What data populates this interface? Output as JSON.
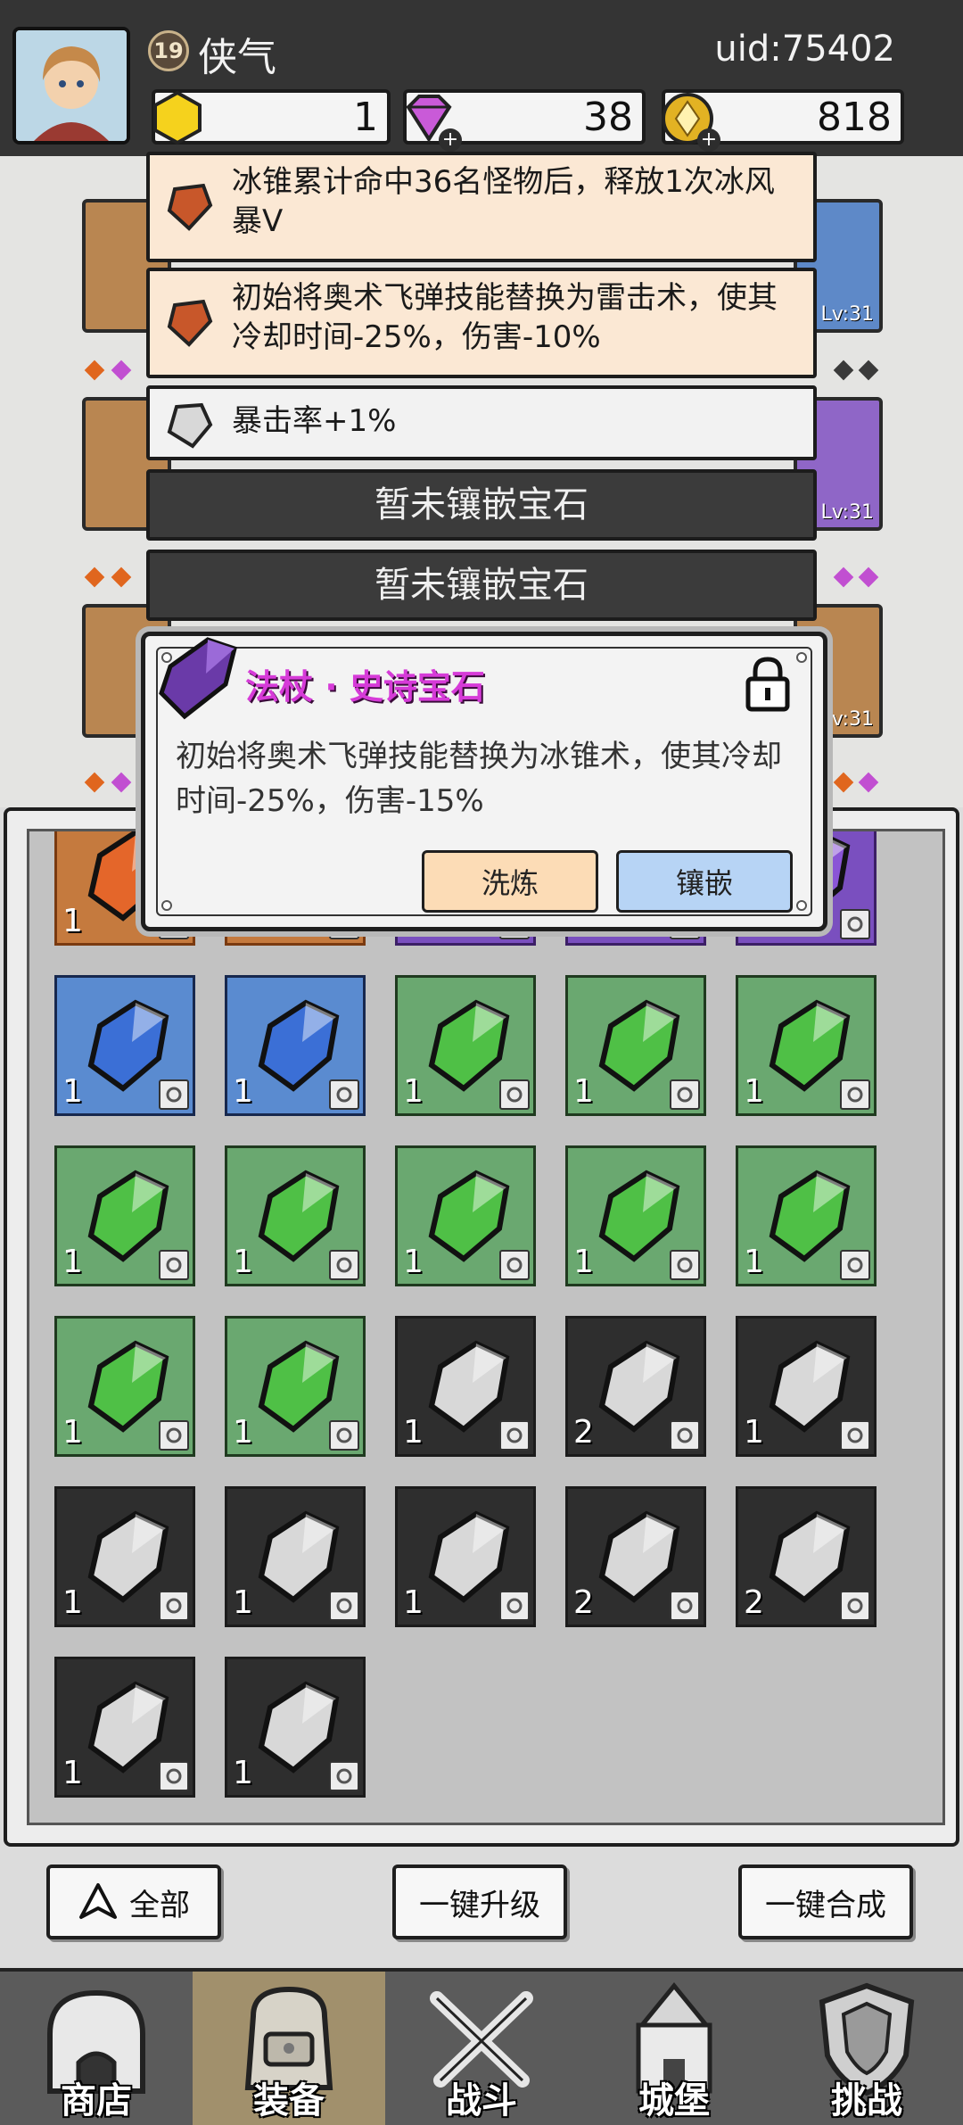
{
  "player": {
    "level": "19",
    "name": "侠气",
    "uid": "uid:75402"
  },
  "resources": [
    {
      "name": "yellow-gem",
      "value": "1",
      "color": "#f5d21d"
    },
    {
      "name": "purple-diamond",
      "value": "38",
      "color": "#c95ad8"
    },
    {
      "name": "gold-coin",
      "value": "818",
      "color": "#e2b223"
    }
  ],
  "sockets": [
    {
      "text": "冰锥累计命中36名怪物后，释放1次冰风暴V"
    },
    {
      "text": "初始将奥术飞弹技能替换为雷击术，使其冷却时间-25%，伤害-10%"
    },
    {
      "text": "暴击率+1%"
    },
    {
      "text": "暂未镶嵌宝石"
    },
    {
      "text": "暂未镶嵌宝石"
    }
  ],
  "equip_levels": [
    "Lv:31",
    "Lv:31",
    "Lv:31"
  ],
  "popup": {
    "title": "法杖 · 史诗宝石",
    "description": "初始将奥术飞弹技能替换为冰锥术，使其冷却时间-25%，伤害-15%",
    "refine_label": "洗炼",
    "inlay_label": "镶嵌"
  },
  "inventory": [
    {
      "color": "orange",
      "count": "1"
    },
    {
      "color": "orange",
      "count": ""
    },
    {
      "color": "purple",
      "count": ""
    },
    {
      "color": "purple",
      "count": ""
    },
    {
      "color": "purple",
      "count": ""
    },
    {
      "color": "blue",
      "count": "1"
    },
    {
      "color": "blue",
      "count": "1"
    },
    {
      "color": "green",
      "count": "1"
    },
    {
      "color": "green",
      "count": "1"
    },
    {
      "color": "green",
      "count": "1"
    },
    {
      "color": "green",
      "count": "1"
    },
    {
      "color": "green",
      "count": "1"
    },
    {
      "color": "green",
      "count": "1"
    },
    {
      "color": "green",
      "count": "1"
    },
    {
      "color": "green",
      "count": "1"
    },
    {
      "color": "green",
      "count": "1"
    },
    {
      "color": "green",
      "count": "1"
    },
    {
      "color": "gray",
      "count": "1"
    },
    {
      "color": "gray",
      "count": "2"
    },
    {
      "color": "gray",
      "count": "1"
    },
    {
      "color": "gray",
      "count": "1"
    },
    {
      "color": "gray",
      "count": "1"
    },
    {
      "color": "gray",
      "count": "1"
    },
    {
      "color": "gray",
      "count": "2"
    },
    {
      "color": "gray",
      "count": "2"
    },
    {
      "color": "gray",
      "count": "1"
    },
    {
      "color": "gray",
      "count": "1"
    }
  ],
  "actions": {
    "filter_label": "全部",
    "upgrade_all_label": "一键升级",
    "merge_all_label": "一键合成"
  },
  "nav": [
    {
      "label": "商店",
      "icon": "shop-icon"
    },
    {
      "label": "装备",
      "icon": "backpack-icon"
    },
    {
      "label": "战斗",
      "icon": "crossed-swords-icon"
    },
    {
      "label": "城堡",
      "icon": "castle-icon"
    },
    {
      "label": "挑战",
      "icon": "shield-icon"
    }
  ]
}
